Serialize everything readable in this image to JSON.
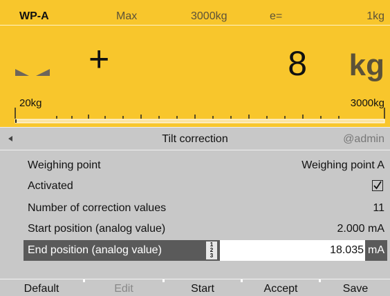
{
  "topbar": {
    "weighing_point": "WP-A",
    "max_label": "Max",
    "capacity": "3000kg",
    "e_label": "e=",
    "division": "1kg"
  },
  "display": {
    "sign": "+",
    "weight_value": "8",
    "weight_unit": "kg",
    "scale_min": "20kg",
    "scale_max": "3000kg"
  },
  "menu": {
    "title": "Tilt correction",
    "user": "@admin",
    "rows": [
      {
        "label": "Weighing point",
        "value": "Weighing point A"
      },
      {
        "label": "Activated",
        "value": ""
      },
      {
        "label": "Number of correction values",
        "value": "11"
      },
      {
        "label": "Start position (analog value)",
        "value": "2.000 mA"
      }
    ],
    "edit_row": {
      "label": "End position (analog value)",
      "numpad": [
        "1",
        "2",
        "3"
      ],
      "value": "18.035",
      "unit": "mA"
    }
  },
  "softkeys": [
    {
      "label": "Default",
      "enabled": true
    },
    {
      "label": "Edit",
      "enabled": false
    },
    {
      "label": "Start",
      "enabled": true
    },
    {
      "label": "Accept",
      "enabled": true
    },
    {
      "label": "Save",
      "enabled": true
    }
  ],
  "colors": {
    "display_bg": "#f8c62c",
    "menu_bg": "#c8c8c8",
    "selected_row_bg": "#5a5a5a"
  },
  "icons": {
    "zero_marks": "zero-triangles-icon",
    "checkbox": "checkbox-checked-icon",
    "back": "back-arrow-icon",
    "numpad": "numeric-input-icon"
  }
}
